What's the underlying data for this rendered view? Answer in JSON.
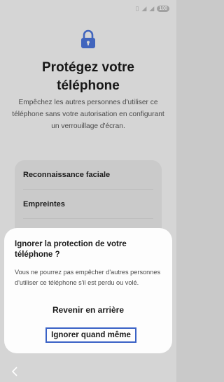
{
  "status_bar": {
    "battery": "100"
  },
  "header": {
    "title": "Protégez votre téléphone",
    "description": "Empêchez les autres personnes d'utiliser ce téléphone sans votre autorisation en configurant un verrouillage d'écran."
  },
  "options": [
    {
      "label": "Reconnaissance faciale"
    },
    {
      "label": "Empreintes"
    }
  ],
  "dialog": {
    "title": "Ignorer la protection de votre téléphone ?",
    "body": "Vous ne pourrez pas empêcher d'autres personnes d'utiliser ce téléphone s'il est perdu ou volé.",
    "back_label": "Revenir en arrière",
    "ignore_label": "Ignorer quand même"
  },
  "colors": {
    "accent": "#3a62c6",
    "lock_icon": "#4a73d8"
  },
  "icons": {
    "lock": "lock-icon",
    "nav_back": "back-arrow-icon"
  }
}
